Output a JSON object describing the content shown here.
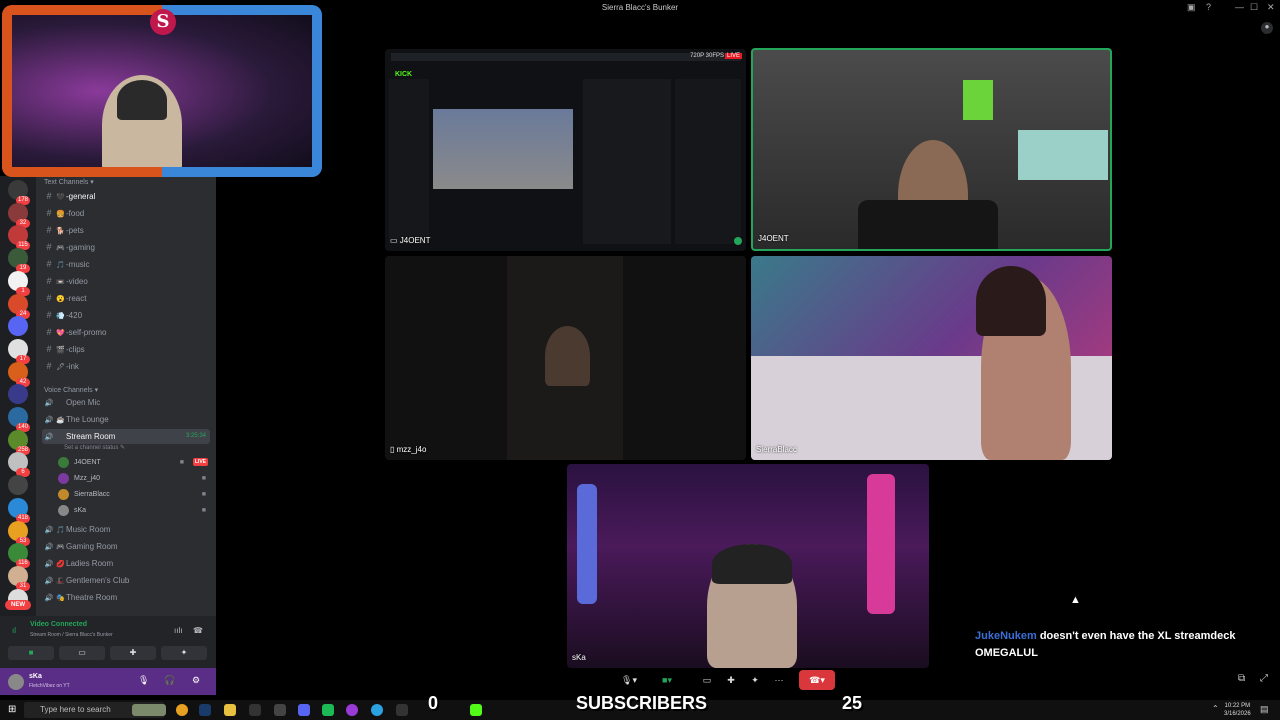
{
  "window": {
    "title": "Sierra Blacc's Bunker"
  },
  "servers": [
    {
      "badge": "178"
    },
    {
      "badge": "32"
    },
    {
      "badge": "115"
    },
    {
      "badge": "19"
    },
    {
      "badge": "1"
    },
    {
      "badge": "24"
    },
    {
      "badge": ""
    },
    {
      "badge": "17"
    },
    {
      "badge": "42"
    },
    {
      "badge": ""
    },
    {
      "badge": "140"
    },
    {
      "badge": "258"
    },
    {
      "badge": "6"
    },
    {
      "badge": ""
    },
    {
      "badge": "418"
    },
    {
      "badge": "53"
    },
    {
      "badge": "116"
    },
    {
      "badge": "31"
    },
    {
      "badge": ""
    }
  ],
  "new_badge": "NEW",
  "text_channels": {
    "header": "Text Channels",
    "items": [
      {
        "emoji": "🖤",
        "label": "-general",
        "active": true
      },
      {
        "emoji": "🍔",
        "label": "-food"
      },
      {
        "emoji": "🐕",
        "label": "-pets"
      },
      {
        "emoji": "🎮",
        "label": "-gaming"
      },
      {
        "emoji": "🎵",
        "label": "-music"
      },
      {
        "emoji": "📼",
        "label": "-video"
      },
      {
        "emoji": "😮",
        "label": "-react"
      },
      {
        "emoji": "💨",
        "label": "-420"
      },
      {
        "emoji": "💖",
        "label": "-self-promo"
      },
      {
        "emoji": "🎬",
        "label": "-clips"
      },
      {
        "emoji": "🖋",
        "label": "-ink"
      }
    ]
  },
  "voice_channels": {
    "header": "Voice Channels",
    "items": [
      {
        "emoji": "",
        "label": "Open Mic"
      },
      {
        "emoji": "☕",
        "label": "The Lounge"
      },
      {
        "emoji": "",
        "label": "Stream Room",
        "selected": true,
        "timer": "3:25:34"
      },
      {
        "emoji": "🎵",
        "label": "Music Room"
      },
      {
        "emoji": "🎮",
        "label": "Gaming Room"
      },
      {
        "emoji": "💋",
        "label": "Ladies Room"
      },
      {
        "emoji": "🎩",
        "label": "Gentlemen's Club"
      },
      {
        "emoji": "🎭",
        "label": "Theatre Room"
      }
    ],
    "stream_room_sub": "Set a channel status ✎",
    "users": [
      {
        "name": "J4OENT",
        "live": "LIVE"
      },
      {
        "name": "Mzz_j40"
      },
      {
        "name": "SierraBlacc"
      },
      {
        "name": "sKa"
      }
    ]
  },
  "voice_panel": {
    "status": "Video Connected",
    "location": "Stream Room / Sierra Blacc's Bunker"
  },
  "user_panel": {
    "name": "sKa",
    "status": "FletchVibez on YT"
  },
  "tiles": [
    {
      "name": "J4OENT"
    },
    {
      "name": "J4OENT"
    },
    {
      "name": "mzz_j4o"
    },
    {
      "name": "SierraBlacc"
    },
    {
      "name": "sKa"
    }
  ],
  "kick": {
    "logo": "KICK",
    "fps": "720P 30FPS",
    "live": "LIVE"
  },
  "chat": {
    "user": "JukeNukem",
    "message": "doesn't even have the XL streamdeck OMEGALUL"
  },
  "taskbar": {
    "search_placeholder": "Type here to search",
    "time": "10:22 PM",
    "date": "3/16/2026"
  },
  "overlay": {
    "left_count": "0",
    "label": "SUBSCRIBERS",
    "right_count": "25"
  },
  "colors": {
    "discord_green": "#23a55a",
    "discord_red": "#f23f42",
    "chat_user": "#3b6fd6"
  }
}
